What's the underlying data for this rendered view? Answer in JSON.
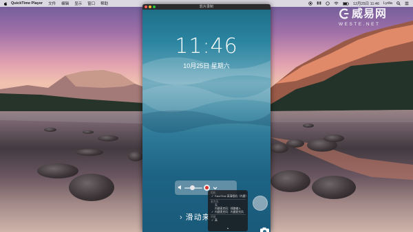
{
  "menubar": {
    "app_name": "QuickTime Player",
    "items": [
      "文件",
      "编辑",
      "显示",
      "窗口",
      "帮助"
    ],
    "clock": "12月25日 11:46",
    "user": "Lydia"
  },
  "watermark": {
    "brand": "威易网",
    "url": "WESTE.NET"
  },
  "window": {
    "title": "影片录制"
  },
  "device": {
    "time": "11:46",
    "date": "10月25日 星期六",
    "slide_text": "滑动来"
  },
  "menu": {
    "rows": [
      {
        "text": "相机",
        "kind": "head"
      },
      {
        "text": "FaceTime 高清相机（内建）",
        "kind": "check"
      },
      {
        "text": "",
        "kind": "sep"
      },
      {
        "text": "麦克风",
        "kind": "head"
      },
      {
        "text": "无",
        "kind": "plain"
      },
      {
        "text": "内建麦克风：线路输入",
        "kind": "plain"
      },
      {
        "text": "内建麦克风：内建麦克风",
        "kind": "check"
      },
      {
        "text": "",
        "kind": "sep"
      },
      {
        "text": "质量",
        "kind": "head"
      },
      {
        "text": "高",
        "kind": "check"
      }
    ]
  },
  "colors": {
    "record": "#d8302a",
    "traffic_close": "#fc5f57",
    "traffic_min": "#fdbc2e",
    "traffic_max": "#28c840"
  }
}
